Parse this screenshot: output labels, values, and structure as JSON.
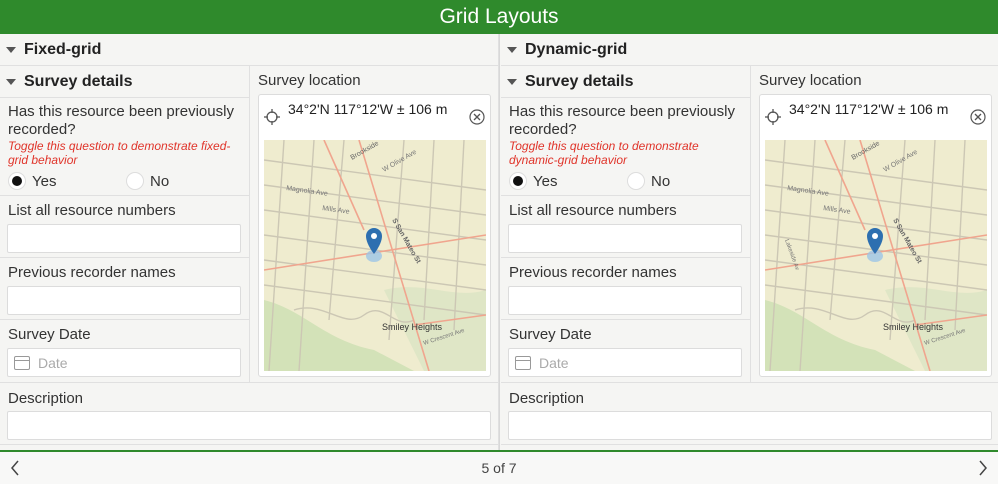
{
  "header": {
    "title": "Grid Layouts"
  },
  "panels": [
    {
      "group_title": "Fixed-grid",
      "section_title": "Survey details",
      "q_previous": "Has this resource been previously recorded?",
      "hint": "Toggle this question to demonstrate fixed-grid behavior",
      "yes_label": "Yes",
      "no_label": "No",
      "selected": "Yes",
      "resource_numbers_label": "List all resource numbers",
      "resource_numbers_value": "",
      "recorder_names_label": "Previous recorder names",
      "recorder_names_value": "",
      "survey_date_label": "Survey Date",
      "date_placeholder": "Date",
      "location_label": "Survey location",
      "location_value": "34°2'N 117°12'W ± 106 m",
      "description_label": "Description",
      "description_value": ""
    },
    {
      "group_title": "Dynamic-grid",
      "section_title": "Survey details",
      "q_previous": "Has this resource been previously recorded?",
      "hint": "Toggle this question to demonstrate dynamic-grid behavior",
      "yes_label": "Yes",
      "no_label": "No",
      "selected": "Yes",
      "resource_numbers_label": "List all resource numbers",
      "resource_numbers_value": "",
      "recorder_names_label": "Previous recorder names",
      "recorder_names_value": "",
      "survey_date_label": "Survey Date",
      "date_placeholder": "Date",
      "location_label": "Survey location",
      "location_value": "34°2'N 117°12'W ± 106 m",
      "description_label": "Description",
      "description_value": ""
    }
  ],
  "map": {
    "streets": [
      "Brookside",
      "Magnolia Ave",
      "Mills Ave",
      "W Olive Ave",
      "S San Mateo St",
      "Smiley Heights",
      "W Crescent Ave",
      "Lakeside Av"
    ],
    "place": "Smiley Heights"
  },
  "footer": {
    "pager": "5 of 7"
  },
  "colors": {
    "header": "#2f8a2c",
    "hint": "#e0342a",
    "pin": "#2d6fb0"
  }
}
